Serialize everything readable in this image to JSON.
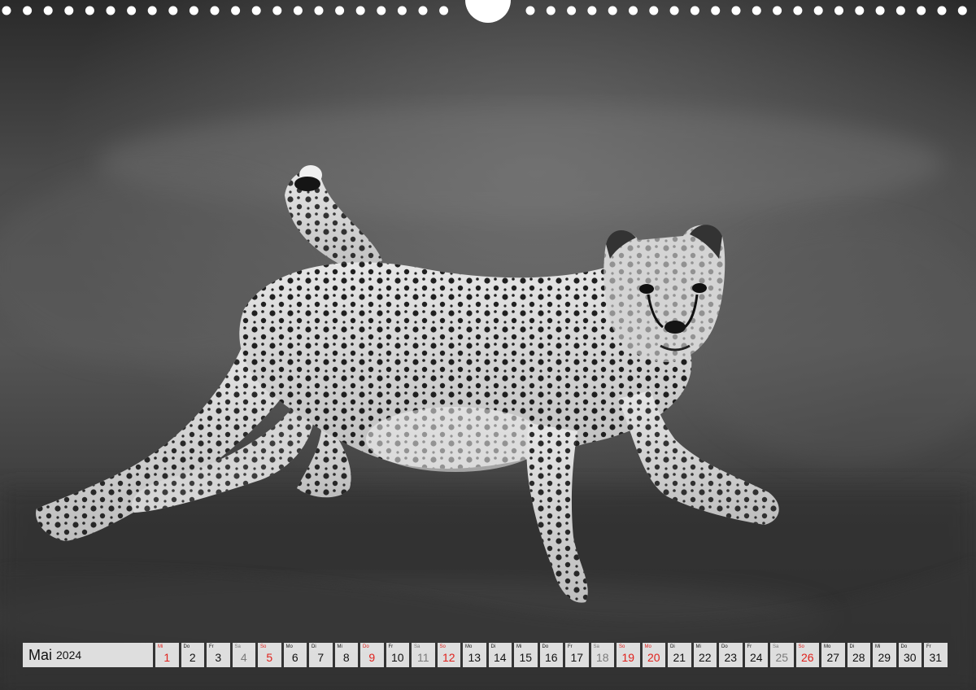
{
  "calendar": {
    "month": "Mai",
    "year": "2024",
    "colors": {
      "weekday": "#111111",
      "saturday": "#7a7a7a",
      "sunday": "#e0201b",
      "cell_bg": "#ececec"
    },
    "days": [
      {
        "wd": "Mi",
        "d": "1",
        "type": "sun"
      },
      {
        "wd": "Do",
        "d": "2",
        "type": "day"
      },
      {
        "wd": "Fr",
        "d": "3",
        "type": "day"
      },
      {
        "wd": "Sa",
        "d": "4",
        "type": "sat"
      },
      {
        "wd": "So",
        "d": "5",
        "type": "sun"
      },
      {
        "wd": "Mo",
        "d": "6",
        "type": "day"
      },
      {
        "wd": "Di",
        "d": "7",
        "type": "day"
      },
      {
        "wd": "Mi",
        "d": "8",
        "type": "day"
      },
      {
        "wd": "Do",
        "d": "9",
        "type": "sun"
      },
      {
        "wd": "Fr",
        "d": "10",
        "type": "day"
      },
      {
        "wd": "Sa",
        "d": "11",
        "type": "sat"
      },
      {
        "wd": "So",
        "d": "12",
        "type": "sun"
      },
      {
        "wd": "Mo",
        "d": "13",
        "type": "day"
      },
      {
        "wd": "Di",
        "d": "14",
        "type": "day"
      },
      {
        "wd": "Mi",
        "d": "15",
        "type": "day"
      },
      {
        "wd": "Do",
        "d": "16",
        "type": "day"
      },
      {
        "wd": "Fr",
        "d": "17",
        "type": "day"
      },
      {
        "wd": "Sa",
        "d": "18",
        "type": "sat"
      },
      {
        "wd": "So",
        "d": "19",
        "type": "sun"
      },
      {
        "wd": "Mo",
        "d": "20",
        "type": "sun"
      },
      {
        "wd": "Di",
        "d": "21",
        "type": "day"
      },
      {
        "wd": "Mi",
        "d": "22",
        "type": "day"
      },
      {
        "wd": "Do",
        "d": "23",
        "type": "day"
      },
      {
        "wd": "Fr",
        "d": "24",
        "type": "day"
      },
      {
        "wd": "Sa",
        "d": "25",
        "type": "sat"
      },
      {
        "wd": "So",
        "d": "26",
        "type": "sun"
      },
      {
        "wd": "Mo",
        "d": "27",
        "type": "day"
      },
      {
        "wd": "Di",
        "d": "28",
        "type": "day"
      },
      {
        "wd": "Mi",
        "d": "29",
        "type": "day"
      },
      {
        "wd": "Do",
        "d": "30",
        "type": "day"
      },
      {
        "wd": "Fr",
        "d": "31",
        "type": "day"
      }
    ]
  }
}
